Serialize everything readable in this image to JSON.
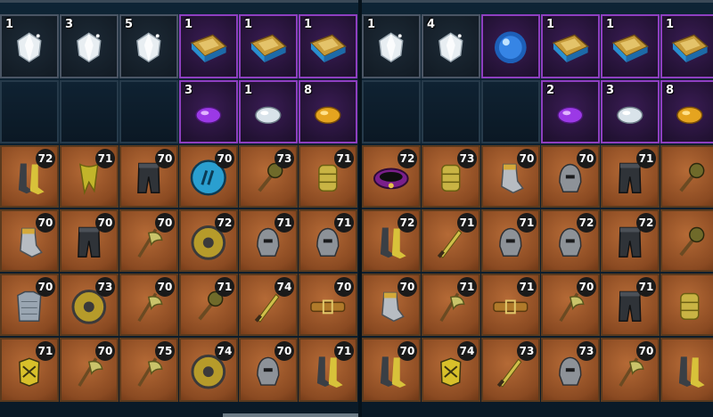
{
  "left": {
    "resources": [
      {
        "count": "1",
        "icon": "crystal-icon"
      },
      {
        "count": "3",
        "icon": "crystal-icon"
      },
      {
        "count": "5",
        "icon": "crystal-icon"
      },
      {
        "count": "1",
        "icon": "spellbook-icon"
      },
      {
        "count": "1",
        "icon": "spellbook-icon"
      },
      {
        "count": "1",
        "icon": "spellbook-icon"
      }
    ],
    "gems": [
      {
        "count": "",
        "icon": ""
      },
      {
        "count": "",
        "icon": ""
      },
      {
        "count": "",
        "icon": ""
      },
      {
        "count": "3",
        "icon": "purple-gem-icon"
      },
      {
        "count": "1",
        "icon": "white-gem-icon"
      },
      {
        "count": "8",
        "icon": "gold-gem-icon"
      }
    ],
    "gear": [
      [
        {
          "level": "72",
          "icon": "boots-icon"
        },
        {
          "level": "71",
          "icon": "scarf-icon"
        },
        {
          "level": "70",
          "icon": "pants-icon"
        },
        {
          "level": "70",
          "icon": "rune-shield-icon"
        },
        {
          "level": "73",
          "icon": "mace-icon"
        },
        {
          "level": "71",
          "icon": "bracer-icon"
        }
      ],
      [
        {
          "level": "70",
          "icon": "gauntlet-icon"
        },
        {
          "level": "70",
          "icon": "pants-icon"
        },
        {
          "level": "70",
          "icon": "axe-icon"
        },
        {
          "level": "72",
          "icon": "round-shield-icon"
        },
        {
          "level": "71",
          "icon": "helmet-icon"
        },
        {
          "level": "71",
          "icon": "helmet-icon"
        }
      ],
      [
        {
          "level": "70",
          "icon": "chainmail-icon"
        },
        {
          "level": "73",
          "icon": "round-shield-icon"
        },
        {
          "level": "70",
          "icon": "axe-icon"
        },
        {
          "level": "71",
          "icon": "mace-icon"
        },
        {
          "level": "74",
          "icon": "dagger-icon"
        },
        {
          "level": "70",
          "icon": "belt-icon"
        }
      ],
      [
        {
          "level": "71",
          "icon": "gloves-icon"
        },
        {
          "level": "70",
          "icon": "axe-icon"
        },
        {
          "level": "75",
          "icon": "axe-icon"
        },
        {
          "level": "74",
          "icon": "round-shield-icon"
        },
        {
          "level": "70",
          "icon": "helmet-icon"
        },
        {
          "level": "71",
          "icon": "boots-icon"
        }
      ]
    ]
  },
  "right": {
    "resources": [
      {
        "count": "1",
        "icon": "crystal-icon"
      },
      {
        "count": "4",
        "icon": "crystal-icon"
      },
      {
        "count": "",
        "icon": "blue-orb-icon"
      },
      {
        "count": "1",
        "icon": "spellbook-icon"
      },
      {
        "count": "1",
        "icon": "spellbook-icon"
      },
      {
        "count": "1",
        "icon": "spellbook-icon"
      }
    ],
    "gems": [
      {
        "count": "",
        "icon": ""
      },
      {
        "count": "",
        "icon": ""
      },
      {
        "count": "",
        "icon": ""
      },
      {
        "count": "2",
        "icon": "purple-gem-icon"
      },
      {
        "count": "3",
        "icon": "white-gem-icon"
      },
      {
        "count": "8",
        "icon": "gold-gem-icon"
      }
    ],
    "gear": [
      [
        {
          "level": "72",
          "icon": "collar-icon"
        },
        {
          "level": "73",
          "icon": "bracer-icon"
        },
        {
          "level": "70",
          "icon": "gauntlet-icon"
        },
        {
          "level": "70",
          "icon": "helmet-icon"
        },
        {
          "level": "71",
          "icon": "pants-icon"
        },
        {
          "level": "",
          "icon": "mace-icon"
        }
      ],
      [
        {
          "level": "72",
          "icon": "boots-icon"
        },
        {
          "level": "71",
          "icon": "dagger-icon"
        },
        {
          "level": "71",
          "icon": "helmet-icon"
        },
        {
          "level": "72",
          "icon": "helmet-icon"
        },
        {
          "level": "72",
          "icon": "pants-icon"
        },
        {
          "level": "",
          "icon": "mace-icon"
        }
      ],
      [
        {
          "level": "70",
          "icon": "gauntlet-icon"
        },
        {
          "level": "71",
          "icon": "axe-icon"
        },
        {
          "level": "71",
          "icon": "belt-icon"
        },
        {
          "level": "70",
          "icon": "axe-icon"
        },
        {
          "level": "71",
          "icon": "pants-icon"
        },
        {
          "level": "",
          "icon": "bracer-icon"
        }
      ],
      [
        {
          "level": "70",
          "icon": "boots-icon"
        },
        {
          "level": "74",
          "icon": "gloves-icon"
        },
        {
          "level": "73",
          "icon": "dagger-icon"
        },
        {
          "level": "73",
          "icon": "helmet-icon"
        },
        {
          "level": "70",
          "icon": "axe-icon"
        },
        {
          "level": "",
          "icon": "boots-icon"
        }
      ]
    ]
  },
  "colors": {
    "panel": "#0e2435",
    "gear_slot": "#a15a2b",
    "rare_border": "#8e3fc0",
    "common_border": "#4a5564"
  }
}
